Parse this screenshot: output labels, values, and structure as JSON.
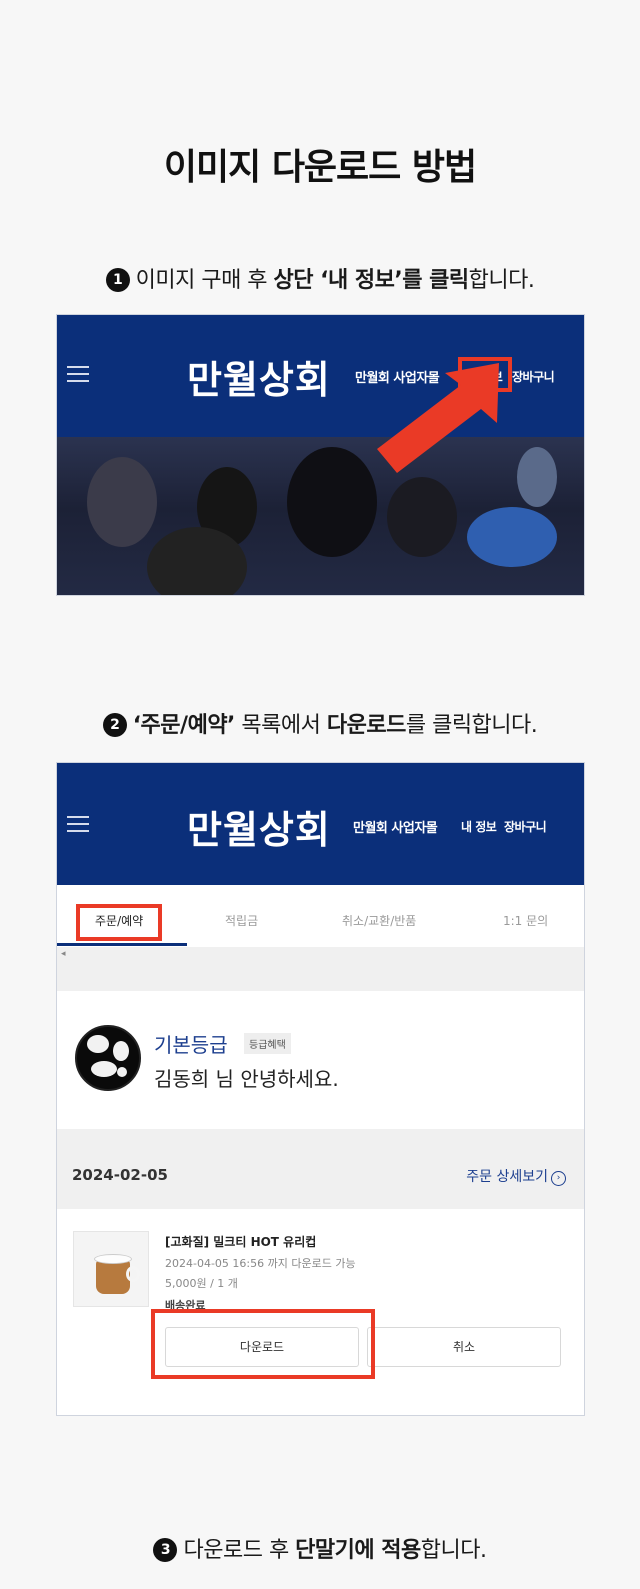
{
  "page": {
    "title": "이미지 다운로드 방법"
  },
  "steps": [
    {
      "num": "1",
      "text_a": "이미지 구매 후 ",
      "text_b": "상단 ‘내 정보’를 클릭",
      "text_c": "합니다."
    },
    {
      "num": "2",
      "text_a": "‘주문/예약’",
      "text_b": " 목록에서 ",
      "text_c": "다운로드",
      "text_d": "를 클릭합니다."
    },
    {
      "num": "3",
      "text_a": "다운로드 후 ",
      "text_b": "단말기에 적용",
      "text_c": "합니다."
    }
  ],
  "header": {
    "logo": "만월상회",
    "links": {
      "mall": "만월회 사업자몰",
      "my_info": "내 정보",
      "cart": "장바구니"
    }
  },
  "tabs": [
    "주문/예약",
    "적립금",
    "취소/교환/반품",
    "1:1 문의"
  ],
  "profile": {
    "grade": "기본등급",
    "grade_badge": "등급혜택",
    "greeting": "김동희 님 안녕하세요."
  },
  "order": {
    "date": "2024-02-05",
    "detail_link": "주문 상세보기",
    "product_name": "[고화질] 밀크티 HOT 유리컵",
    "download_until": "2024-04-05 16:56 까지 다운로드 가능",
    "price": "5,000원 / 1 개",
    "status": "배송완료",
    "download_button": "다운로드",
    "cancel_button": "취소"
  },
  "colors": {
    "brand_navy": "#0b2f7a",
    "highlight_red": "#ea3a26"
  },
  "icons": {
    "menu": "hamburger-icon",
    "pointer": "red-arrow-icon",
    "detail": "chevron-right-circle-icon"
  }
}
